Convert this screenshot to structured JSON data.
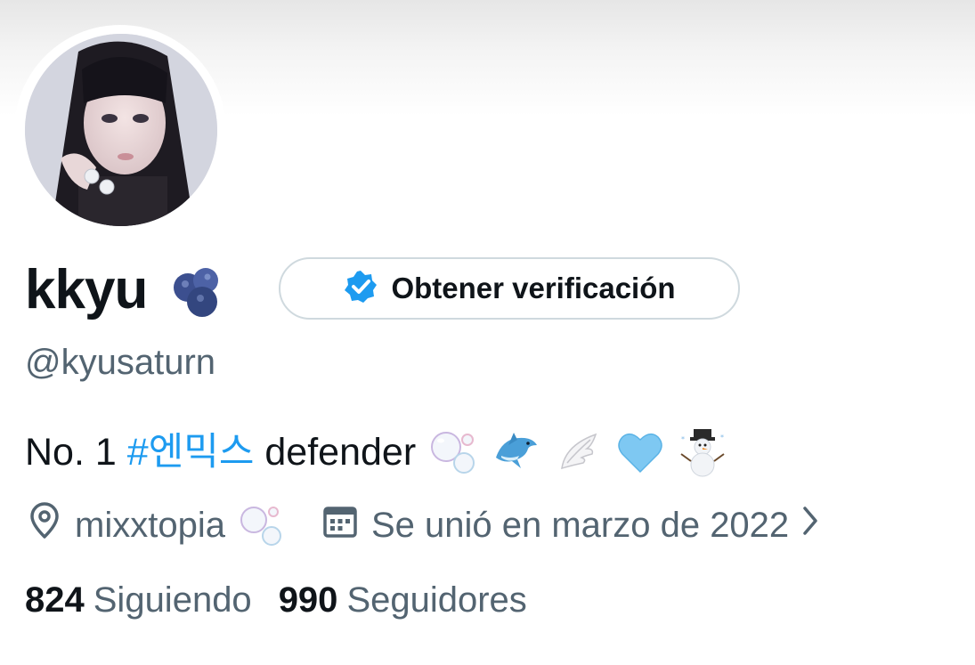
{
  "profile": {
    "display_name": "kkyu",
    "name_emoji": "blueberries-icon",
    "handle": "@kyusaturn",
    "verify_button_label": "Obtener verificación",
    "bio": {
      "prefix": "No. 1",
      "hashtag": "#엔믹스",
      "suffix": "defender",
      "emojis": [
        "bubbles-icon",
        "dolphin-icon",
        "wing-icon",
        "light-blue-heart-icon",
        "snowman-icon"
      ]
    },
    "location": "mixxtopia",
    "location_emoji": "bubbles-icon",
    "joined": "Se unió en marzo de 2022",
    "following_count": "824",
    "following_label": "Siguiendo",
    "followers_count": "990",
    "followers_label": "Seguidores"
  },
  "colors": {
    "link": "#1d9bf0",
    "secondary_text": "#536471",
    "primary_text": "#0f1419",
    "border": "#cfd9de"
  }
}
